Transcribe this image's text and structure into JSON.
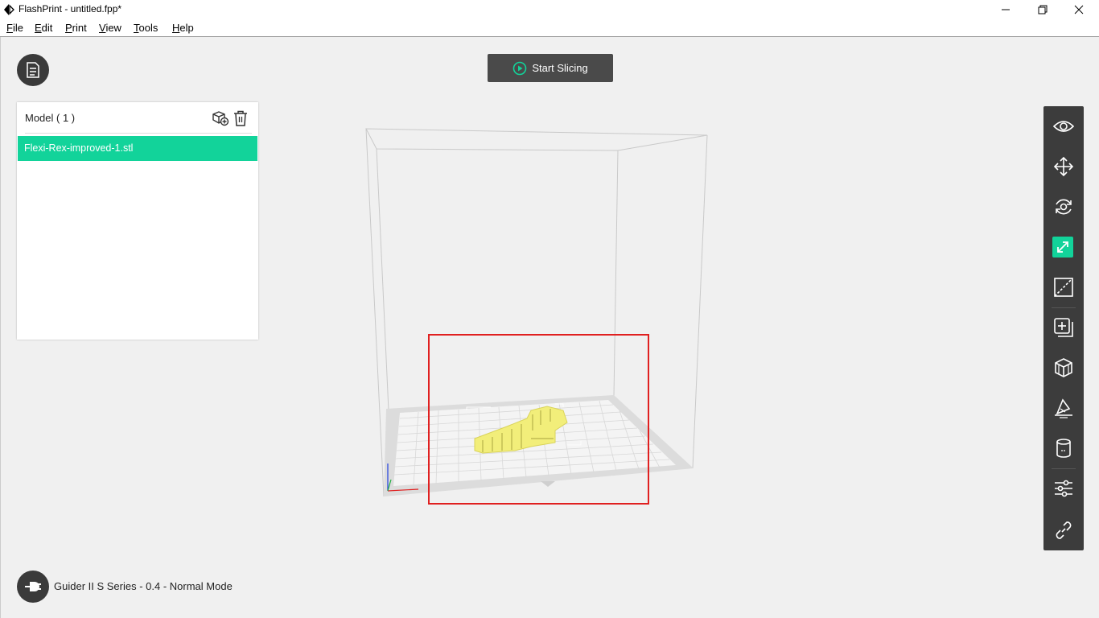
{
  "window": {
    "title": "FlashPrint - untitled.fpp*",
    "controls": [
      "minimize",
      "restore",
      "close"
    ]
  },
  "menu": {
    "items": [
      "File",
      "Edit",
      "Print",
      "View",
      "Tools",
      "Help"
    ]
  },
  "toolbar": {
    "start_slicing_label": "Start Slicing"
  },
  "model_panel": {
    "header": "Model ( 1 )",
    "files": [
      "Flexi-Rex-improved-1.stl"
    ]
  },
  "status": {
    "printer": "Guider II S Series - 0.4 - Normal Mode"
  },
  "right_tools": [
    "view-icon",
    "move-icon",
    "rotate-icon",
    "scale-icon",
    "cut-icon",
    "add-copy-icon",
    "supports-icon",
    "lay-flat-icon",
    "cylinder-icon",
    "settings-icon",
    "link-icon"
  ],
  "active_tool": "scale-icon",
  "colors": {
    "accent": "#12d39a",
    "toolbar_bg": "#3c3c3c",
    "highlight": "#e02020",
    "model": "#f2ee7a"
  }
}
